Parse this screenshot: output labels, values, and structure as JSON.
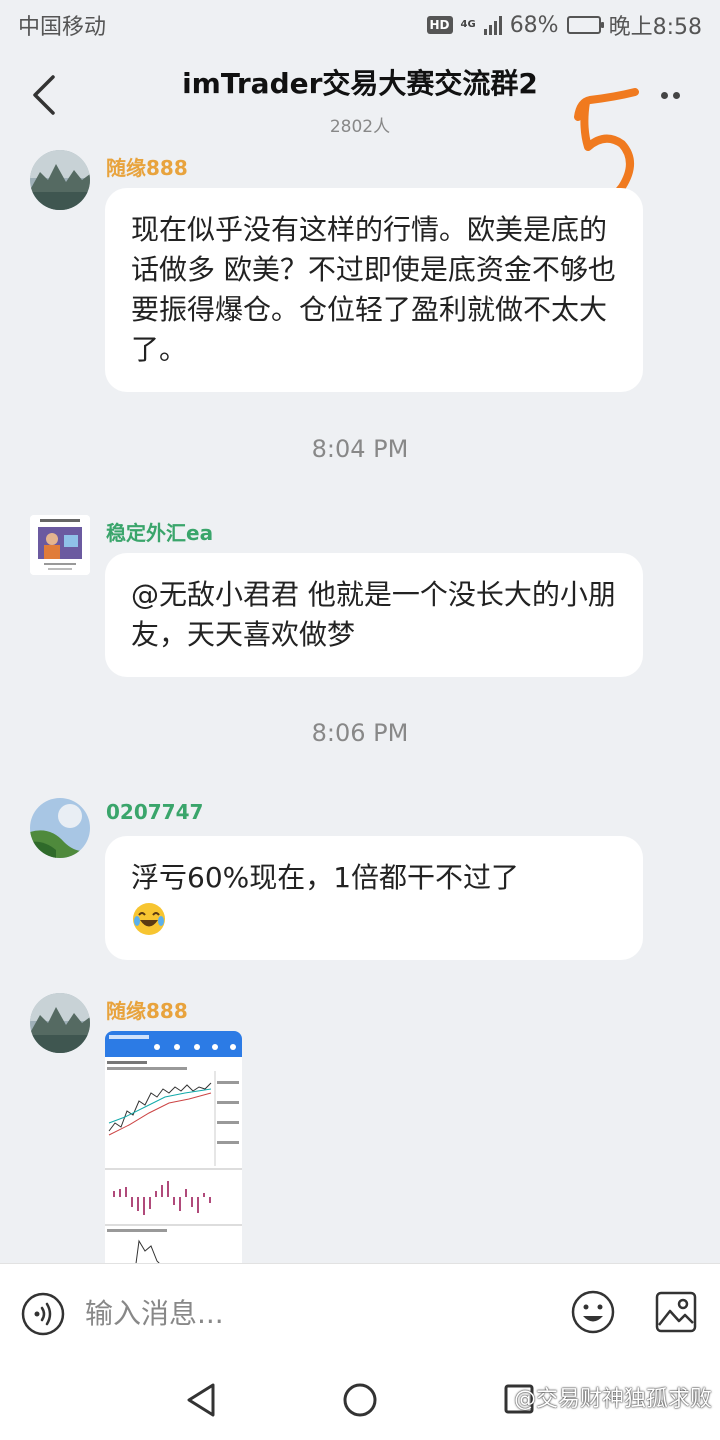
{
  "status_bar": {
    "carrier": "中国移动",
    "hd": "HD",
    "network": "4G",
    "battery_percent": "68%",
    "battery_level": 0.68,
    "time": "晚上8:58"
  },
  "header": {
    "title": "imTrader交易大赛交流群2",
    "member_count": "2802人",
    "annotation": "5"
  },
  "messages": [
    {
      "sender": "随缘888",
      "sender_color": "#e8a33d",
      "text": "现在似乎没有这样的行情。欧美是底的话做多 欧美？不过即使是底资金不够也要振得爆仓。仓位轻了盈利就做不太大了。"
    },
    {
      "sender": "稳定外汇ea",
      "sender_color": "#3aa56b",
      "text": "@无敌小君君 他就是一个没长大的小朋友，天天喜欢做梦"
    },
    {
      "sender": "0207747",
      "sender_color": "#3aa56b",
      "text": "浮亏60%现在，1倍都干不过了"
    },
    {
      "sender": "随缘888",
      "sender_color": "#e8a33d",
      "image": "chart-screenshot"
    }
  ],
  "timestamps": [
    "8:04 PM",
    "8:06 PM"
  ],
  "input": {
    "placeholder": "输入消息..."
  },
  "watermark": "@交易财神独孤求败",
  "colors": {
    "background": "#eef0f3",
    "annotation": "#f07a1f"
  }
}
